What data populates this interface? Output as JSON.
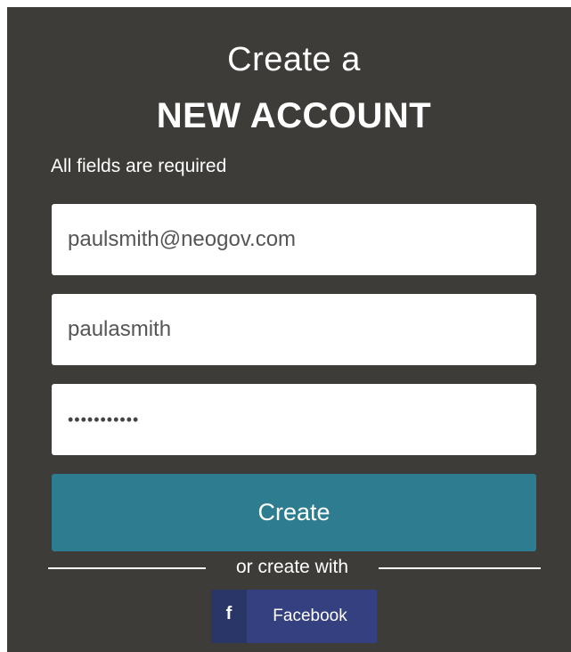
{
  "header": {
    "title_line1": "Create a",
    "title_line2": "NEW ACCOUNT",
    "note": "All fields are required"
  },
  "form": {
    "email_value": "paulsmith@neogov.com",
    "username_value": "paulasmith",
    "password_value": "•••••••••••",
    "create_label": "Create"
  },
  "alt_signup": {
    "divider_text": "or create with",
    "facebook_label": "Facebook",
    "facebook_icon": "facebook-icon"
  },
  "colors": {
    "panel_bg": "#3d3c38",
    "create_button": "#2e7c8f",
    "facebook_button": "#344080"
  }
}
